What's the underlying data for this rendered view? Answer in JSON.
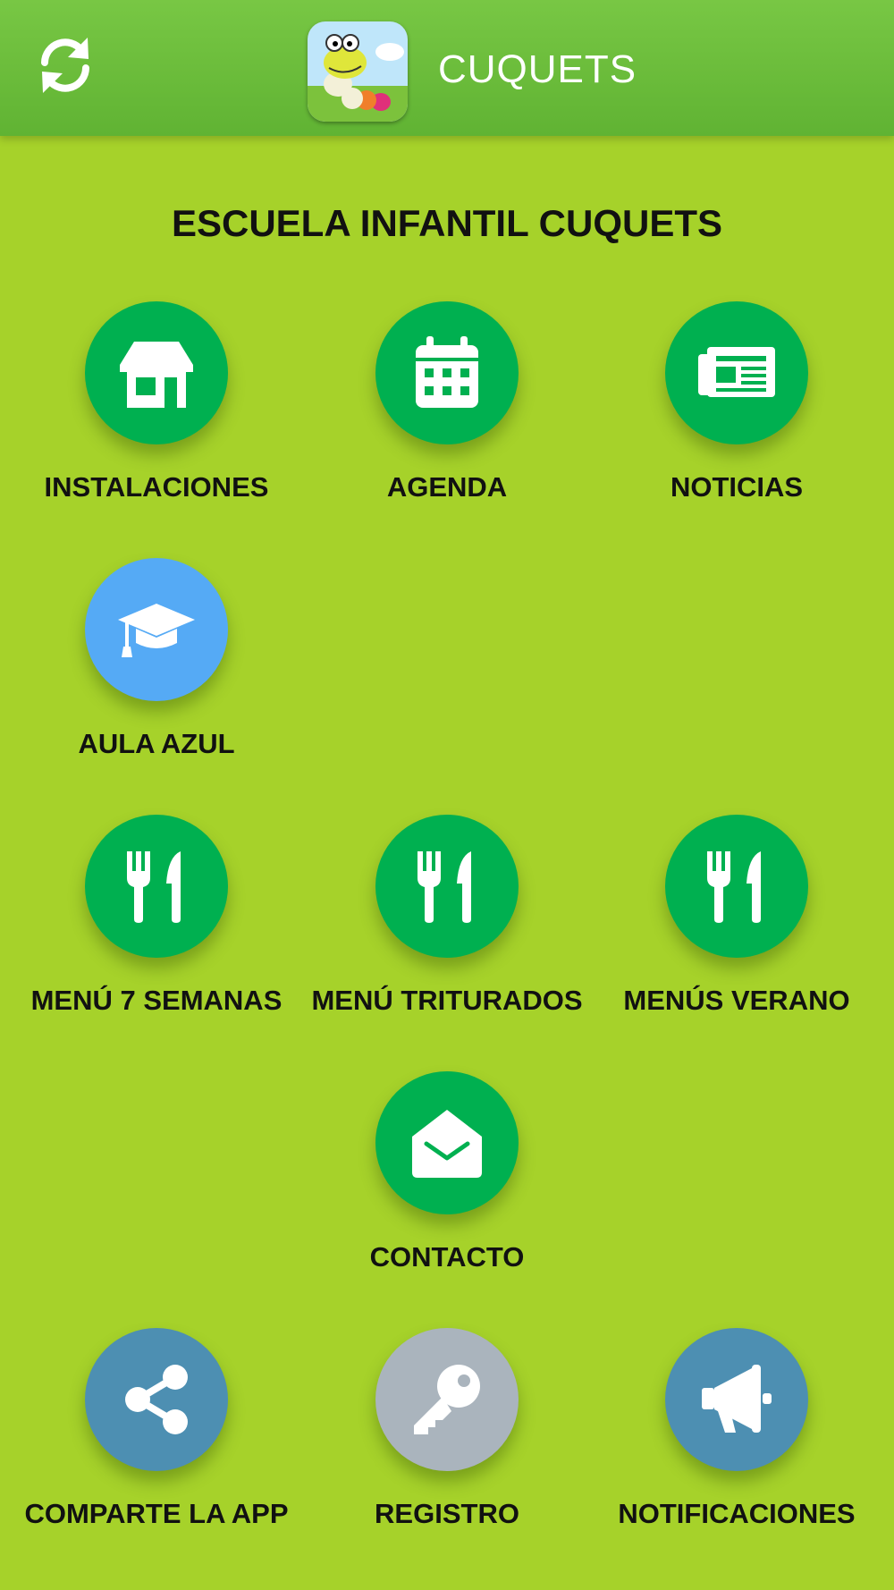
{
  "header": {
    "title": "CUQUETS",
    "refresh_icon": "refresh-icon",
    "logo": "caterpillar-app-logo"
  },
  "heading": "ESCUELA INFANTIL CUQUETS",
  "colors": {
    "background": "#a6d22a",
    "header": "#66b936",
    "green_button": "#00b050",
    "blue_button": "#55aaf5",
    "steel_button": "#4d8fb2",
    "gray_button": "#aab4bd"
  },
  "tiles": [
    {
      "label": "INSTALACIONES",
      "icon": "shop-icon"
    },
    {
      "label": "AGENDA",
      "icon": "calendar-icon"
    },
    {
      "label": "NOTICIAS",
      "icon": "newspaper-icon"
    },
    {
      "label": "AULA AZUL",
      "icon": "graduation-cap-icon"
    },
    {
      "label": "MENÚ 7 SEMANAS",
      "icon": "cutlery-icon"
    },
    {
      "label": "MENÚ TRITURADOS",
      "icon": "cutlery-icon"
    },
    {
      "label": "MENÚS VERANO",
      "icon": "cutlery-icon"
    },
    {
      "label": "CONTACTO",
      "icon": "envelope-open-icon"
    },
    {
      "label": "COMPARTE LA APP",
      "icon": "share-icon"
    },
    {
      "label": "REGISTRO",
      "icon": "key-icon"
    },
    {
      "label": "NOTIFICACIONES",
      "icon": "megaphone-icon"
    }
  ]
}
